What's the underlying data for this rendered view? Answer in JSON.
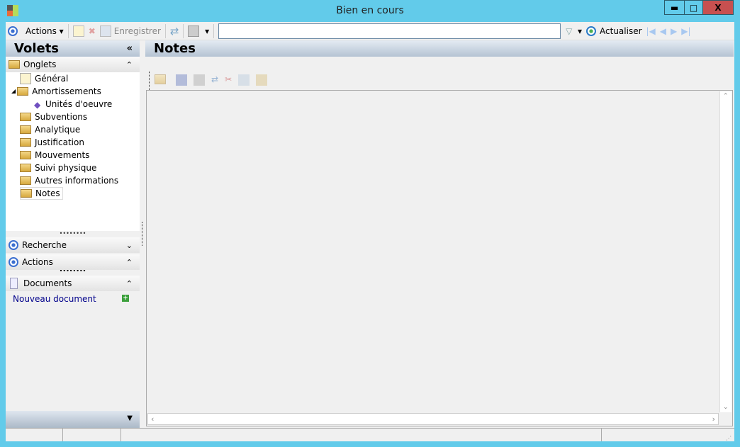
{
  "window": {
    "title": "Bien en cours",
    "minimize": "▬",
    "maximize": "□",
    "close": "X"
  },
  "toolbar": {
    "actions": "Actions",
    "save": "Enregistrer",
    "refresh": "Actualiser",
    "search_value": ""
  },
  "left": {
    "title": "Volets",
    "collapse": "«",
    "onglets": {
      "title": "Onglets",
      "items": [
        {
          "label": "Général"
        },
        {
          "label": "Amortissements"
        },
        {
          "label": "Unités d'oeuvre"
        },
        {
          "label": "Subventions"
        },
        {
          "label": "Analytique"
        },
        {
          "label": "Justification"
        },
        {
          "label": "Mouvements"
        },
        {
          "label": "Suivi physique"
        },
        {
          "label": "Autres informations"
        },
        {
          "label": "Notes"
        }
      ]
    },
    "recherche": "Recherche",
    "actions": "Actions",
    "documents": "Documents",
    "new_doc": "Nouveau document"
  },
  "main": {
    "title": "Notes"
  },
  "colors": {
    "border": "#62cbea",
    "close": "#c75050",
    "link": "#00008b"
  }
}
